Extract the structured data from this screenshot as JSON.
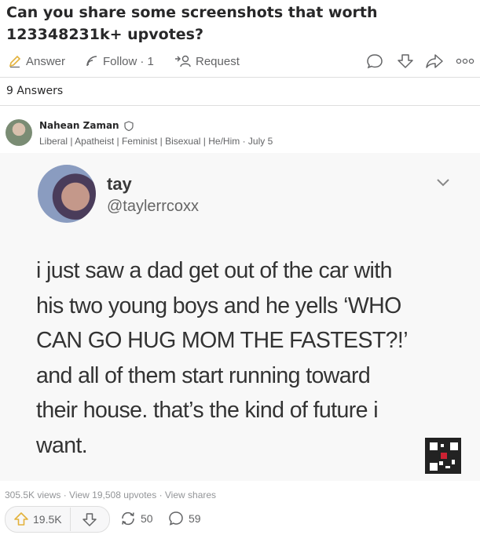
{
  "question": {
    "title_line1": "Can you share some screenshots that worth",
    "title_line2": "123348231k+ upvotes?"
  },
  "question_actions": {
    "answer_label": "Answer",
    "follow_label": "Follow",
    "follow_count": "· 1",
    "request_label": "Request"
  },
  "answers_count_label": "9 Answers",
  "answer": {
    "author_name": "Nahean Zaman",
    "credentials": "Liberal | Apatheist | Feminist | Bisexual | He/Him · July 5",
    "tweet": {
      "name": "tay",
      "handle": "@taylerrcoxx",
      "lines": [
        "i just saw a dad get out of the car with",
        "his two young boys and he yells ‘WHO",
        "CAN GO HUG MOM THE FASTEST?!’",
        "and all of them start running toward",
        "their house. that’s the kind of future i",
        "want."
      ]
    },
    "stats": "305.5K views · View 19,508 upvotes · View shares",
    "upvote_count": "19.5K",
    "share_count": "50",
    "comment_count": "59"
  },
  "colors": {
    "text": "#282829",
    "muted": "#636466",
    "divider": "#dedede",
    "tweet_bg": "#f8f8f8"
  },
  "icons": [
    "answer-icon",
    "follow-icon",
    "request-icon",
    "comment-icon",
    "downvote-icon",
    "share-icon",
    "more-icon",
    "verified-icon",
    "chevron-down-icon",
    "upvote-icon",
    "reshare-icon",
    "qr-code-icon"
  ]
}
